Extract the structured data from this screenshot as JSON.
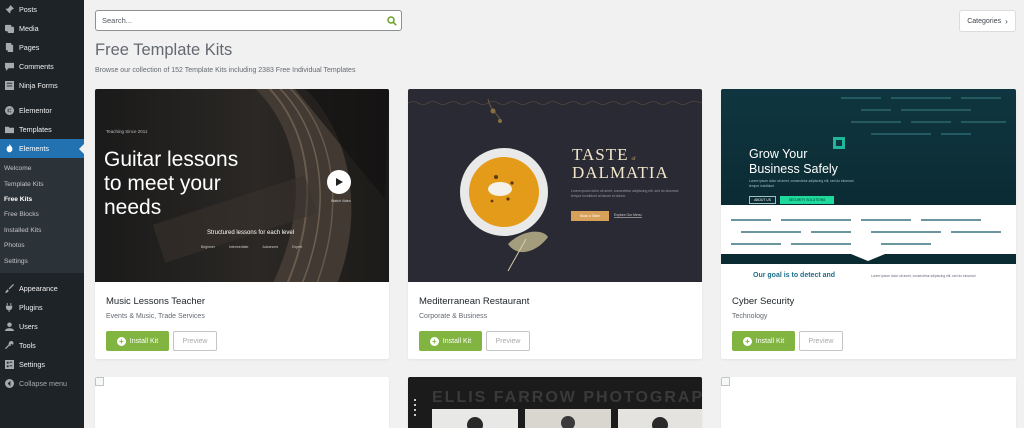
{
  "sidebar": {
    "items_top": [
      {
        "label": "Posts",
        "icon": "pin-icon"
      },
      {
        "label": "Media",
        "icon": "media-icon"
      },
      {
        "label": "Pages",
        "icon": "pages-icon"
      },
      {
        "label": "Comments",
        "icon": "comment-icon"
      },
      {
        "label": "Ninja Forms",
        "icon": "forms-icon"
      }
    ],
    "items_mid": [
      {
        "label": "Elementor",
        "icon": "elementor-icon"
      },
      {
        "label": "Templates",
        "icon": "folder-icon"
      },
      {
        "label": "Elements",
        "icon": "flame-icon"
      }
    ],
    "submenu": [
      "Welcome",
      "Template Kits",
      "Free Kits",
      "Free Blocks",
      "Installed Kits",
      "Photos",
      "Settings"
    ],
    "items_bottom": [
      {
        "label": "Appearance",
        "icon": "brush-icon"
      },
      {
        "label": "Plugins",
        "icon": "plug-icon"
      },
      {
        "label": "Users",
        "icon": "user-icon"
      },
      {
        "label": "Tools",
        "icon": "wrench-icon"
      },
      {
        "label": "Settings",
        "icon": "settings-icon"
      }
    ],
    "collapse": "Collapse menu"
  },
  "search": {
    "placeholder": "Search..."
  },
  "categories_label": "Categories",
  "page_title": "Free Template Kits",
  "page_subtitle": "Browse our collection of 152 Template Kits including 2383 Free Individual Templates",
  "install_label": "Install Kit",
  "preview_label": "Preview",
  "kits": [
    {
      "title": "Music Lessons Teacher",
      "category": "Events & Music, Trade Services",
      "thumb": {
        "small": "Teaching Since 2011",
        "headline": [
          "Guitar lessons",
          "to meet your",
          "needs"
        ],
        "tagline": "Structured lessons for each level",
        "levels": [
          "Beginner",
          "Intermediate",
          "Advanced",
          "Expert"
        ],
        "video_label": "Watch Video"
      }
    },
    {
      "title": "Mediterranean Restaurant",
      "category": "Corporate & Business",
      "thumb": {
        "headline1": "TASTE",
        "of": "of",
        "headline2": "DALMATIA",
        "body": "Lorem ipsum dolor sit amet, consectetur adipiscing elit, sed do eiusmod tempor incididunt ut labore et dolore.",
        "btn1": "Book a Table",
        "btn2": "Explore Our Menu"
      }
    },
    {
      "title": "Cyber Security",
      "category": "Technology",
      "thumb": {
        "headline": [
          "Grow Your",
          "Business Safely"
        ],
        "body": "Lorem ipsum dolor sit amet, consectetur adipiscing elit, sed do eiusmod tempor incididunt",
        "btn1": "ABOUT US",
        "btn2": "SECURITY SOLUTIONS",
        "goal": "Our goal is to detect and",
        "goal_body": "Lorem ipsum dolor sit amet, consectetur adipiscing elit, sed do eiusmod"
      }
    }
  ],
  "photo_kit_heading": "ELLIS FARROW PHOTOGRAPHY",
  "colors": {
    "sidebar": "#1d2327",
    "active": "#2271b1",
    "install": "#81b441",
    "search_icon": "#6aa127"
  }
}
